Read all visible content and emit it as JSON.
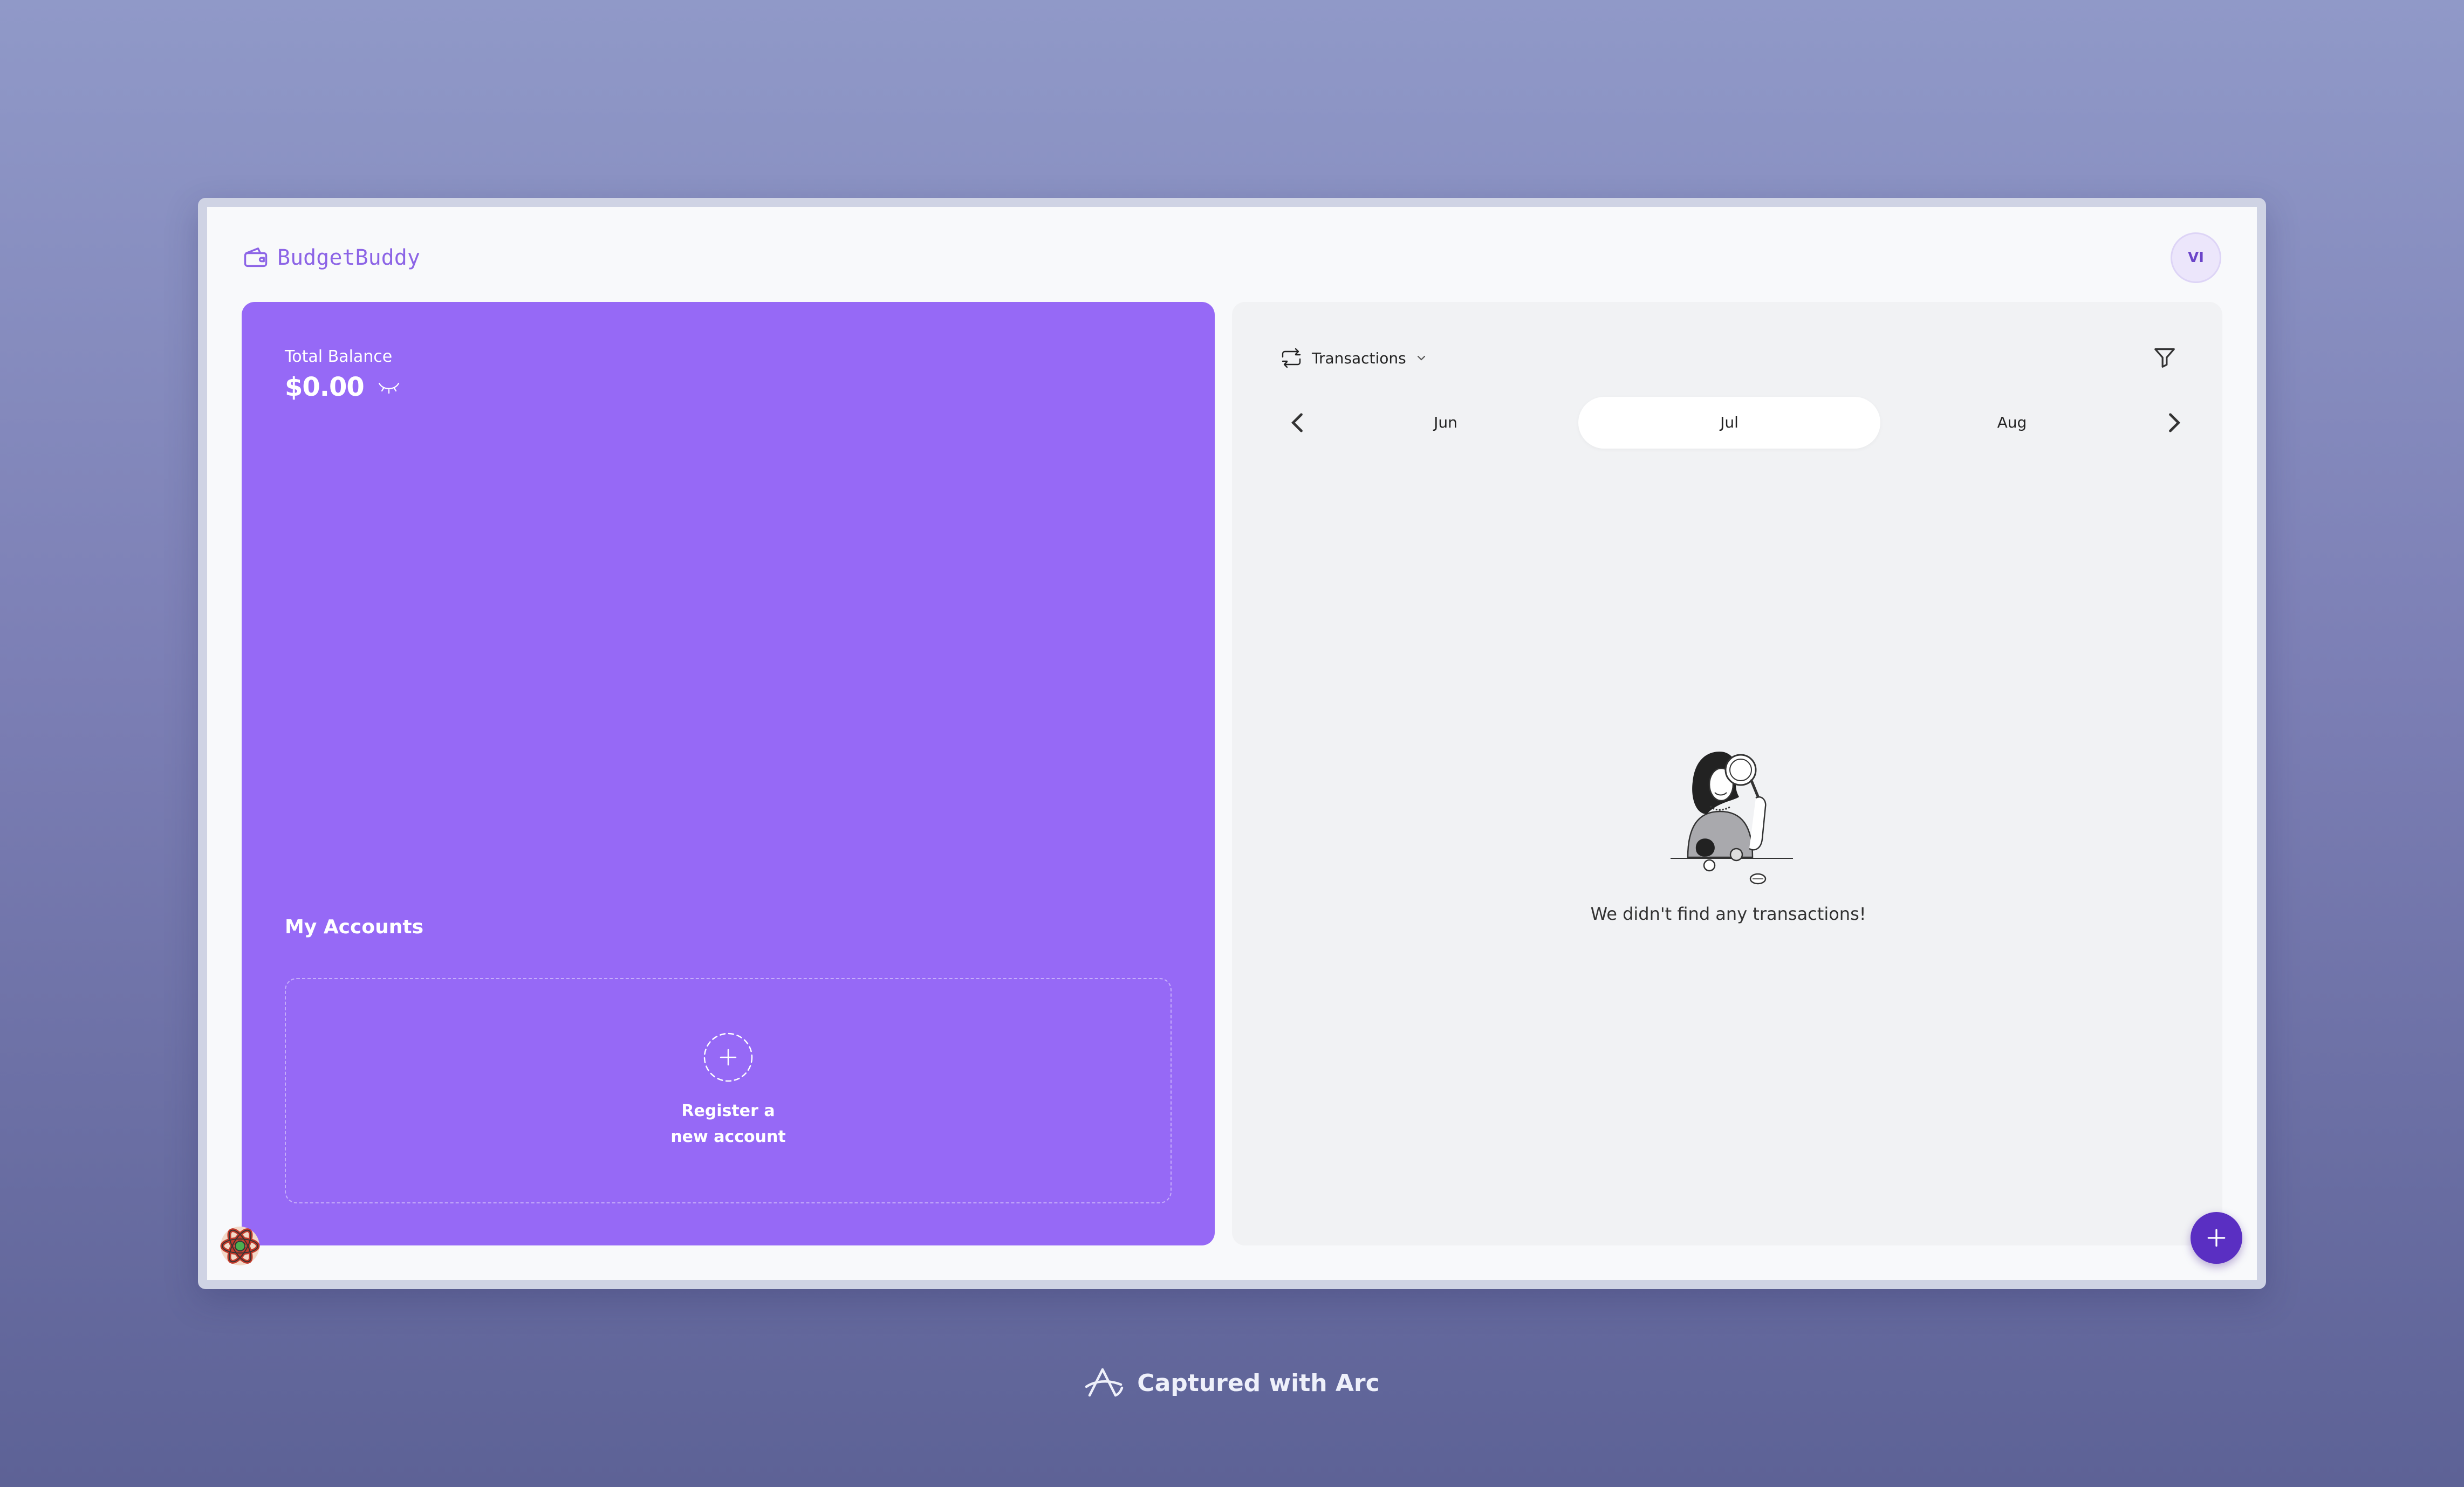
{
  "app": {
    "name": "BudgetBuddy"
  },
  "user": {
    "initials": "VI"
  },
  "balance": {
    "label": "Total Balance",
    "value": "$0.00"
  },
  "accounts": {
    "title": "My Accounts",
    "register_label": "Register a new account"
  },
  "transactions": {
    "selector_label": "Transactions",
    "empty_message": "We didn't find any transactions!"
  },
  "months": {
    "prev": "Jun",
    "current": "Jul",
    "next": "Aug"
  },
  "footer": {
    "captured_text": "Captured with Arc"
  },
  "colors": {
    "accent": "#9669f6",
    "fab": "#5a2fc2",
    "panel_bg": "#f1f2f4"
  },
  "icons": [
    "wallet-icon",
    "eye-closed-icon",
    "plus-circle-icon",
    "transactions-swap-icon",
    "chevron-down-icon",
    "filter-icon",
    "chevron-left-icon",
    "chevron-right-icon",
    "plus-icon",
    "react-devtools-icon",
    "arc-logo-icon"
  ]
}
